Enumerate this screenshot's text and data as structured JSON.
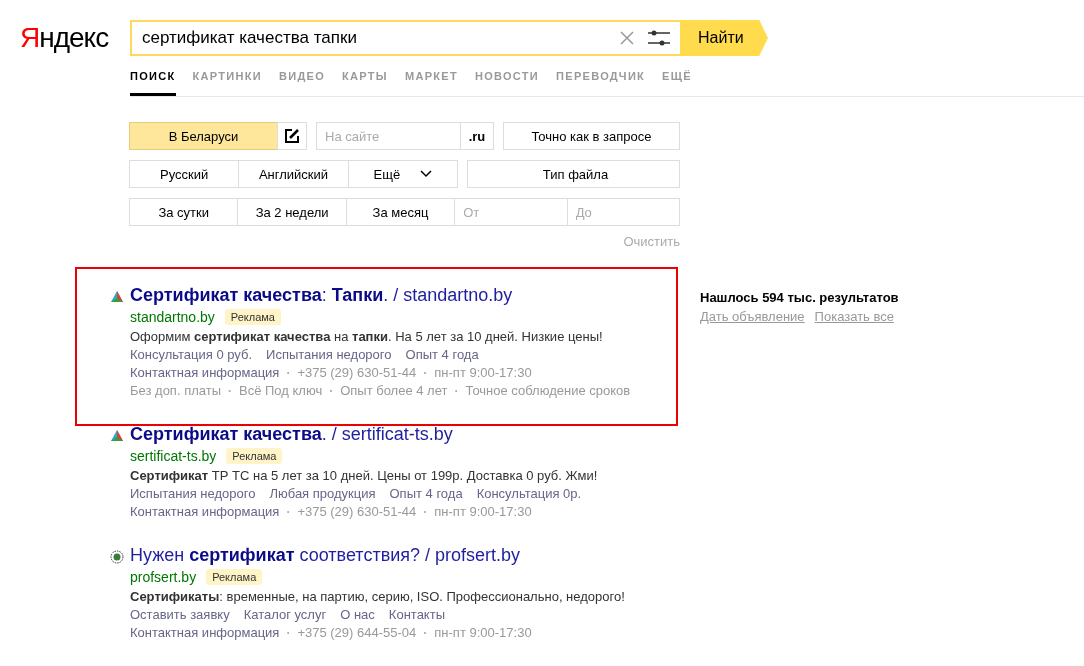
{
  "logo": "Яндекс",
  "search": {
    "value": "сертификат качества тапки",
    "button": "Найти"
  },
  "tabs": [
    {
      "label": "ПОИСК",
      "selected": true
    },
    {
      "label": "КАРТИНКИ",
      "selected": false
    },
    {
      "label": "ВИДЕО",
      "selected": false
    },
    {
      "label": "КАРТЫ",
      "selected": false
    },
    {
      "label": "МАРКЕТ",
      "selected": false
    },
    {
      "label": "НОВОСТИ",
      "selected": false
    },
    {
      "label": "ПЕРЕВОДЧИК",
      "selected": false
    },
    {
      "label": "ЕЩЁ",
      "selected": false
    }
  ],
  "filters": {
    "region": {
      "label": "В Беларуси",
      "selected": true
    },
    "site": {
      "placeholder": "На сайте",
      "zone": ".ru"
    },
    "exact": "Точно как в запросе",
    "languages": [
      {
        "label": "Русский",
        "selected": false
      },
      {
        "label": "Английский",
        "selected": false
      },
      {
        "label": "Ещё",
        "selected": false
      }
    ],
    "filetype": "Тип файла",
    "periods": [
      {
        "label": "За сутки",
        "selected": false
      },
      {
        "label": "За 2 недели",
        "selected": false
      },
      {
        "label": "За месяц",
        "selected": false
      }
    ],
    "from": {
      "placeholder": "От"
    },
    "to": {
      "placeholder": "До"
    },
    "clear": "Очистить"
  },
  "results": [
    {
      "highlighted": true,
      "kind": "triangle",
      "title": "**Сертификат качества**: **Тапки**. / standartno.by",
      "domain": "standartno.by",
      "ad": "Реклама",
      "snippet": "Оформим **сертификат качества** на **тапки**. На 5 лет за 10 дней. Низкие цены!",
      "links": [
        "Консультация 0 руб.",
        "Испытания недорого",
        "Опыт 4 года"
      ],
      "separator": "·",
      "contacts": [
        "Контактная информация",
        "+375 (29) 630-51-44",
        "пн-пт 9:00-17:30"
      ],
      "features": [
        "Без доп. платы",
        "Всё Под ключ",
        "Опыт более 4 лет",
        "Точное соблюдение сроков"
      ]
    },
    {
      "highlighted": false,
      "kind": "triangle",
      "title": "**Сертификат качества**. / sertificat-ts.by",
      "domain": "sertificat-ts.by",
      "ad": "Реклама",
      "snippet": "**Сертификат** ТР ТС на 5 лет за 10 дней. Цены от 199р. Доставка 0 руб. Жми!",
      "links": [
        "Испытания недорого",
        "Любая продукция",
        "Опыт 4 года",
        "Консультация 0р."
      ],
      "separator": "·",
      "contacts": [
        "Контактная информация",
        "+375 (29) 630-51-44",
        "пн-пт 9:00-17:30"
      ]
    },
    {
      "highlighted": false,
      "kind": "seal",
      "title": "Нужен **сертификат** соответствия? / profsert.by",
      "domain": "profsert.by",
      "ad": "Реклама",
      "snippet": "**Сертификаты**: временные, на партию, серию, ISO. Профессионально, недорого!",
      "links": [
        "Оставить заявку",
        "Каталог услуг",
        "О нас",
        "Контакты"
      ],
      "separator": "·",
      "contacts": [
        "Контактная информация",
        "+375 (29) 644-55-04",
        "пн-пт 9:00-17:30"
      ]
    }
  ],
  "aside": {
    "count": "Нашлось 594 тыс. результатов",
    "links": [
      "Дать объявление",
      "Показать все"
    ]
  }
}
